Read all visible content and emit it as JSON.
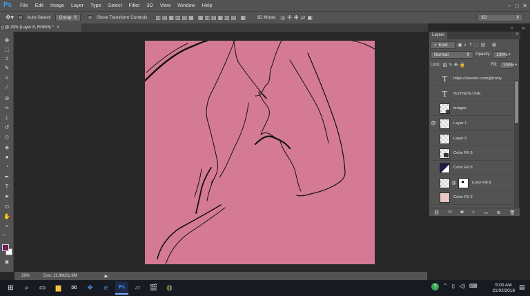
{
  "app": {
    "logo": "Ps"
  },
  "menu": [
    "File",
    "Edit",
    "Image",
    "Layer",
    "Type",
    "Select",
    "Filter",
    "3D",
    "View",
    "Window",
    "Help"
  ],
  "window_controls": {
    "min": "–",
    "max": "□",
    "close": "✕"
  },
  "options": {
    "auto_select_label": "Auto-Select:",
    "group_value": "Group",
    "show_transform_label": "Show Transform Controls",
    "mode_3d_label": "3D Mode:",
    "workspace_value": "3D"
  },
  "document": {
    "tab_title": "g @ 29% (Layer 6, RGB/8) *",
    "tab_close": "×"
  },
  "status": {
    "zoom": "29%",
    "doc_size": "Doc: 11.8M/21.9M"
  },
  "layers_panel": {
    "title": "Layers",
    "filter_value": "Kind",
    "blend_mode": "Normal",
    "opacity_label": "Opacity:",
    "opacity_value": "100%",
    "lock_label": "Lock:",
    "fill_label": "Fill:",
    "fill_value": "100%",
    "layers": [
      {
        "name": "https://steemit.com/@trishy",
        "type": "text",
        "visible": false
      },
      {
        "name": "#LOVEISLOVE",
        "type": "text",
        "visible": false
      },
      {
        "name": "images",
        "type": "smart",
        "visible": false
      },
      {
        "name": "Layer 1",
        "type": "pixel",
        "visible": true
      },
      {
        "name": "Layer 5",
        "type": "pixel",
        "visible": false
      },
      {
        "name": "Color Fill 6",
        "type": "fill",
        "visible": false
      },
      {
        "name": "Color Fill 8",
        "type": "fill",
        "visible": false
      },
      {
        "name": "Color Fill 9",
        "type": "fill-mask",
        "visible": false
      },
      {
        "name": "Color Fill 2",
        "type": "fill",
        "visible": false
      }
    ]
  },
  "taskbar": {
    "time": "5:00 AM",
    "date": "21/02/2018"
  },
  "colors": {
    "canvas": "#d47a95",
    "foreground": "#6d1f5b",
    "background": "#ffffff",
    "ps_blue": "#38a0f4"
  }
}
